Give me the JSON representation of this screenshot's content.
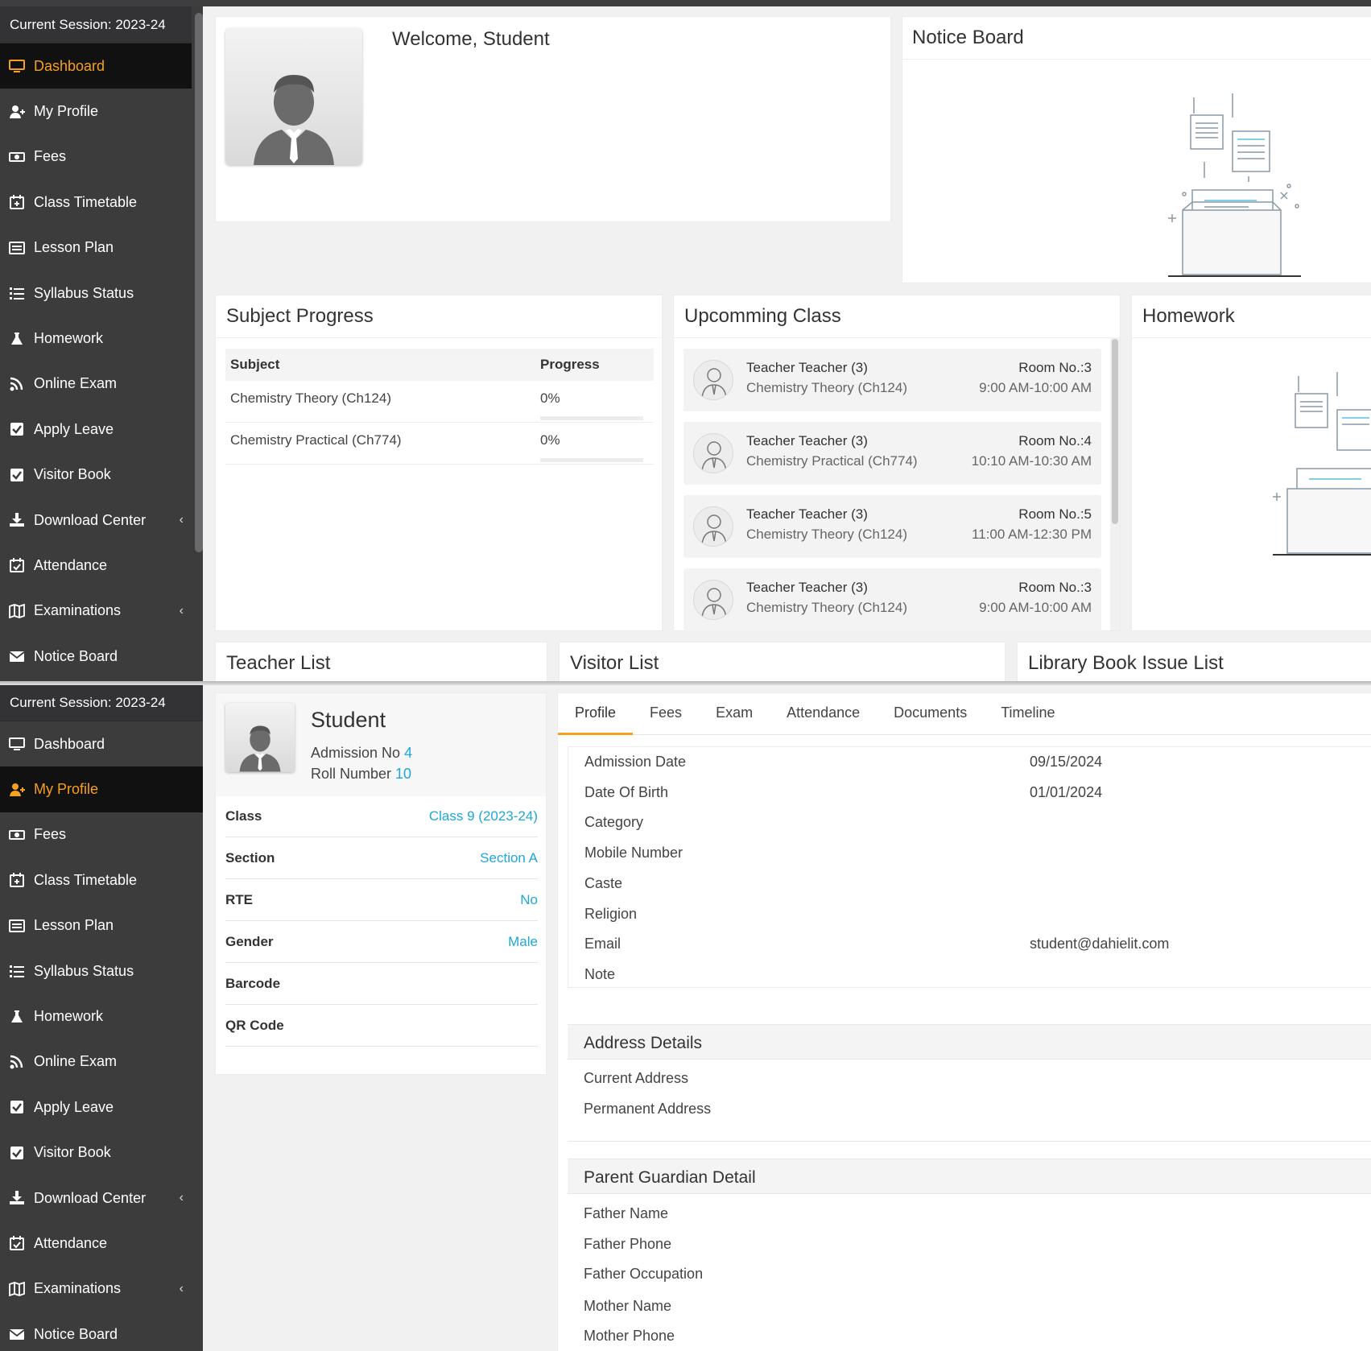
{
  "top": {
    "session": "Current Session: 2023-24",
    "menu": [
      {
        "label": "Dashboard",
        "icon": "monitor-icon",
        "active": true
      },
      {
        "label": "My Profile",
        "icon": "user-plus-icon"
      },
      {
        "label": "Fees",
        "icon": "money-icon"
      },
      {
        "label": "Class Timetable",
        "icon": "calendar-plus-icon"
      },
      {
        "label": "Lesson Plan",
        "icon": "list-alt-icon"
      },
      {
        "label": "Syllabus Status",
        "icon": "list-icon"
      },
      {
        "label": "Homework",
        "icon": "flask-icon"
      },
      {
        "label": "Online Exam",
        "icon": "rss-icon"
      },
      {
        "label": "Apply Leave",
        "icon": "check-square-icon"
      },
      {
        "label": "Visitor Book",
        "icon": "check-square-icon"
      },
      {
        "label": "Download Center",
        "icon": "download-icon",
        "chevron": "‹"
      },
      {
        "label": "Attendance",
        "icon": "calendar-check-icon"
      },
      {
        "label": "Examinations",
        "icon": "map-icon",
        "chevron": "‹"
      },
      {
        "label": "Notice Board",
        "icon": "envelope-icon"
      }
    ],
    "welcome": "Welcome, Student",
    "notice_board_title": "Notice Board",
    "subject_progress": {
      "title": "Subject Progress",
      "headers": [
        "Subject",
        "Progress"
      ],
      "rows": [
        {
          "subject": "Chemistry Theory (Ch124)",
          "progress": "0%",
          "fraction": 0
        },
        {
          "subject": "Chemistry Practical (Ch774)",
          "progress": "0%",
          "fraction": 0
        }
      ]
    },
    "upcoming": {
      "title": "Upcomming Class",
      "items": [
        {
          "teacher": "Teacher Teacher (3)",
          "subject": "Chemistry Theory (Ch124)",
          "room": "Room No.:3",
          "time": "9:00 AM-10:00 AM"
        },
        {
          "teacher": "Teacher Teacher (3)",
          "subject": "Chemistry Practical (Ch774)",
          "room": "Room No.:4",
          "time": "10:10 AM-10:30 AM"
        },
        {
          "teacher": "Teacher Teacher (3)",
          "subject": "Chemistry Theory (Ch124)",
          "room": "Room No.:5",
          "time": "11:00 AM-12:30 PM"
        },
        {
          "teacher": "Teacher Teacher (3)",
          "subject": "Chemistry Theory (Ch124)",
          "room": "Room No.:3",
          "time": "9:00 AM-10:00 AM"
        }
      ]
    },
    "homework_title": "Homework",
    "teacher_list_title": "Teacher List",
    "visitor_list_title": "Visitor List",
    "library_title": "Library Book Issue List"
  },
  "bottom": {
    "session": "Current Session: 2023-24",
    "menu": [
      {
        "label": "Dashboard",
        "icon": "monitor-icon"
      },
      {
        "label": "My Profile",
        "icon": "user-plus-icon",
        "active": true
      },
      {
        "label": "Fees",
        "icon": "money-icon"
      },
      {
        "label": "Class Timetable",
        "icon": "calendar-plus-icon"
      },
      {
        "label": "Lesson Plan",
        "icon": "list-alt-icon"
      },
      {
        "label": "Syllabus Status",
        "icon": "list-icon"
      },
      {
        "label": "Homework",
        "icon": "flask-icon"
      },
      {
        "label": "Online Exam",
        "icon": "rss-icon"
      },
      {
        "label": "Apply Leave",
        "icon": "check-square-icon"
      },
      {
        "label": "Visitor Book",
        "icon": "check-square-icon"
      },
      {
        "label": "Download Center",
        "icon": "download-icon",
        "chevron": "‹"
      },
      {
        "label": "Attendance",
        "icon": "calendar-check-icon"
      },
      {
        "label": "Examinations",
        "icon": "map-icon",
        "chevron": "‹"
      },
      {
        "label": "Notice Board",
        "icon": "envelope-icon"
      }
    ],
    "profile": {
      "name": "Student",
      "admission_label": "Admission No",
      "admission_no": "4",
      "roll_label": "Roll Number",
      "roll_no": "10",
      "info": [
        {
          "key": "Class",
          "value": "Class 9 (2023-24)"
        },
        {
          "key": "Section",
          "value": "Section A"
        },
        {
          "key": "RTE",
          "value": "No"
        },
        {
          "key": "Gender",
          "value": "Male"
        },
        {
          "key": "Barcode",
          "value": ""
        },
        {
          "key": "QR Code",
          "value": ""
        }
      ]
    },
    "tabs": [
      "Profile",
      "Fees",
      "Exam",
      "Attendance",
      "Documents",
      "Timeline"
    ],
    "details": [
      {
        "key": "Admission Date",
        "value": "09/15/2024"
      },
      {
        "key": "Date Of Birth",
        "value": "01/01/2024"
      },
      {
        "key": "Category",
        "value": ""
      },
      {
        "key": "Mobile Number",
        "value": ""
      },
      {
        "key": "Caste",
        "value": ""
      },
      {
        "key": "Religion",
        "value": ""
      },
      {
        "key": "Email",
        "value": "student@dahielit.com"
      },
      {
        "key": "Note",
        "value": ""
      }
    ],
    "address": {
      "title": "Address Details",
      "fields": [
        "Current Address",
        "Permanent Address"
      ]
    },
    "parent": {
      "title": "Parent Guardian Detail",
      "fields": [
        "Father Name",
        "Father Phone",
        "Father Occupation",
        "Mother Name",
        "Mother Phone"
      ]
    }
  },
  "colors": {
    "accent": "#f7a01d",
    "link": "#1ea7d8",
    "sidebar": "#3c3c3d"
  }
}
